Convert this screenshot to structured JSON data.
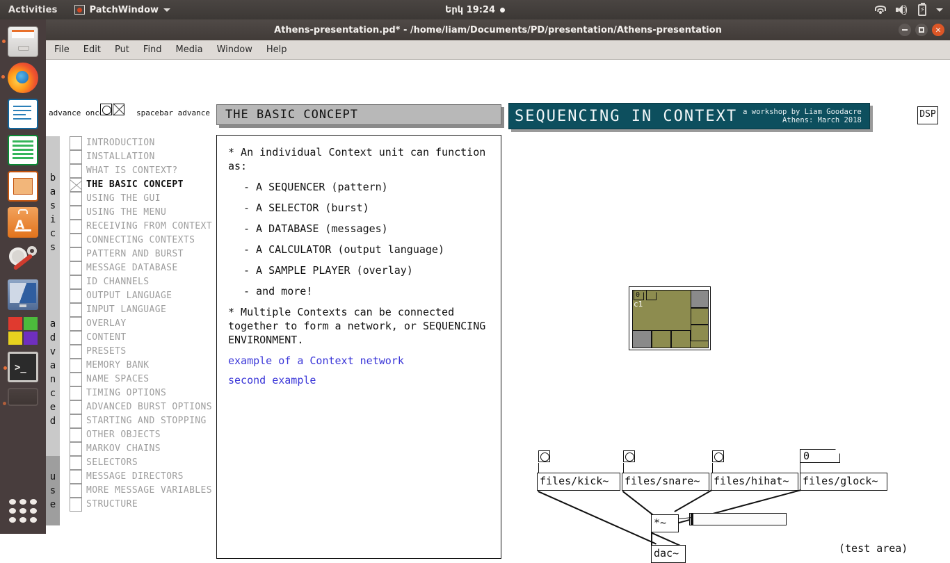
{
  "topbar": {
    "activities": "Activities",
    "app_menu": "PatchWindow",
    "clock": "Երկ 19:24",
    "icons": [
      "wifi-icon",
      "volume-icon",
      "battery-icon",
      "session-caret-icon"
    ]
  },
  "launcher": {
    "items": [
      {
        "name": "files",
        "label": "Files",
        "running": true
      },
      {
        "name": "firefox",
        "label": "Firefox",
        "running": true
      },
      {
        "name": "writer",
        "label": "LibreOffice Writer",
        "running": false
      },
      {
        "name": "calc",
        "label": "LibreOffice Calc",
        "running": false
      },
      {
        "name": "impress",
        "label": "LibreOffice Impress",
        "running": false
      },
      {
        "name": "amazon",
        "label": "Amazon",
        "running": false
      },
      {
        "name": "settings",
        "label": "System Settings",
        "running": false
      },
      {
        "name": "media",
        "label": "Media",
        "running": false
      },
      {
        "name": "blocks",
        "label": "Software",
        "running": false
      },
      {
        "name": "terminal",
        "label": "Terminal",
        "running": true
      },
      {
        "name": "hidden",
        "label": "",
        "running": true
      }
    ],
    "app_grid": "show-applications"
  },
  "window": {
    "title": "Athens-presentation.pd* - /home/liam/Documents/PD/presentation/Athens-presentation",
    "buttons": {
      "minimize": "minimize",
      "maximize": "maximize",
      "close": "close"
    },
    "menu": [
      "File",
      "Edit",
      "Put",
      "Find",
      "Media",
      "Window",
      "Help"
    ]
  },
  "patch": {
    "advance_once_label": "advance once",
    "spacebar_label": "spacebar advance",
    "bang_name": "advance-once-bang",
    "toggle_name": "spacebar-advance-toggle",
    "dsp_label": "DSP",
    "test_area_label": "(test area)"
  },
  "nav": {
    "groups": [
      {
        "band": "basics",
        "dark": false,
        "count": 11
      },
      {
        "band": "advanced",
        "dark": false,
        "count": 12
      },
      {
        "band": "use",
        "dark": true,
        "count": 4
      }
    ],
    "items": [
      {
        "label": "INTRODUCTION",
        "current": false
      },
      {
        "label": "INSTALLATION",
        "current": false
      },
      {
        "label": "WHAT IS CONTEXT?",
        "current": false
      },
      {
        "label": "THE BASIC CONCEPT",
        "current": true
      },
      {
        "label": "USING THE GUI",
        "current": false
      },
      {
        "label": "USING THE MENU",
        "current": false
      },
      {
        "label": "RECEIVING FROM CONTEXT",
        "current": false
      },
      {
        "label": "CONNECTING CONTEXTS",
        "current": false
      },
      {
        "label": "PATTERN AND BURST",
        "current": false
      },
      {
        "label": "MESSAGE DATABASE",
        "current": false
      },
      {
        "label": "ID CHANNELS",
        "current": false
      },
      {
        "label": "OUTPUT LANGUAGE",
        "current": false
      },
      {
        "label": "INPUT LANGUAGE",
        "current": false
      },
      {
        "label": "OVERLAY",
        "current": false
      },
      {
        "label": "CONTENT",
        "current": false
      },
      {
        "label": "PRESETS",
        "current": false
      },
      {
        "label": "MEMORY BANK",
        "current": false
      },
      {
        "label": "NAME SPACES",
        "current": false
      },
      {
        "label": "TIMING OPTIONS",
        "current": false
      },
      {
        "label": "ADVANCED BURST OPTIONS",
        "current": false
      },
      {
        "label": "STARTING AND STOPPING",
        "current": false
      },
      {
        "label": "OTHER OBJECTS",
        "current": false
      },
      {
        "label": "MARKOV CHAINS",
        "current": false
      },
      {
        "label": "SELECTORS",
        "current": false
      },
      {
        "label": "MESSAGE DIRECTORS",
        "current": false
      },
      {
        "label": "MORE MESSAGE VARIABLES",
        "current": false
      },
      {
        "label": "STRUCTURE",
        "current": false
      }
    ]
  },
  "slide": {
    "header": "THE BASIC CONCEPT",
    "paragraphs": [
      {
        "kind": "p",
        "text": "* An individual Context unit can function as:"
      },
      {
        "kind": "li",
        "text": "- A SEQUENCER (pattern)"
      },
      {
        "kind": "li",
        "text": "- A SELECTOR (burst)"
      },
      {
        "kind": "li",
        "text": "- A DATABASE (messages)"
      },
      {
        "kind": "li",
        "text": "- A CALCULATOR (output language)"
      },
      {
        "kind": "li",
        "text": "- A SAMPLE PLAYER (overlay)"
      },
      {
        "kind": "li",
        "text": "- and more!"
      },
      {
        "kind": "p",
        "text": "* Multiple Contexts can be connected together to form a network, or SEQUENCING ENVIRONMENT."
      }
    ],
    "links": [
      {
        "text": "example of a Context network"
      },
      {
        "text": "second example"
      }
    ]
  },
  "banner": {
    "title": "SEQUENCING IN CONTEXT",
    "sub_line1": "a workshop by Liam Goodacre",
    "sub_line2": "Athens: March 2018"
  },
  "context_unit": {
    "number_value": "0",
    "second_number_value": "",
    "label": "c1"
  },
  "sound_chain": {
    "objects": [
      {
        "label": "files/kick~",
        "trigger": "bang"
      },
      {
        "label": "files/snare~",
        "trigger": "bang"
      },
      {
        "label": "files/hihat~",
        "trigger": "bang"
      },
      {
        "label": "files/glock~",
        "trigger": "number",
        "number_value": "0"
      }
    ],
    "multiply": "*~",
    "output": "dac~",
    "slider_name": "volume-slider"
  },
  "colors": {
    "banner_bg": "#0d4f5e",
    "link": "#3a36d8",
    "context_olive": "#8d8c4f",
    "slide_header_bg": "#b8b8b8",
    "accent_orange": "#e8703a"
  }
}
